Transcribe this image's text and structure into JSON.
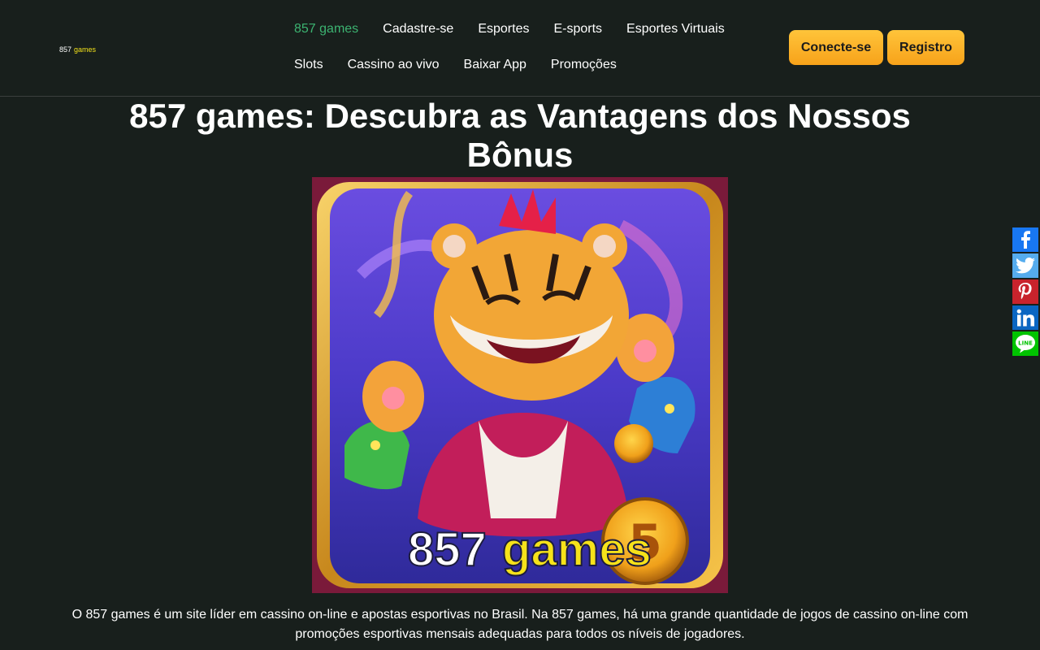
{
  "header": {
    "logo": {
      "number": "857",
      "word": "games"
    },
    "nav": {
      "row1": [
        "857 games",
        "Cadastre-se",
        "Esportes",
        "E-sports",
        "Esportes Virtuais"
      ],
      "row2": [
        "Slots",
        "Cassino ao vivo",
        "Baixar App",
        "Promoções"
      ],
      "active_item": "857 games"
    },
    "auth": {
      "login_label": "Conecte-se",
      "register_label": "Registro"
    }
  },
  "main": {
    "title": "857 games: Descubra as Vantagens dos Nossos Bônus",
    "hero_image": {
      "caption_number": "857",
      "caption_word": "games"
    },
    "intro": "O 857 games é um site líder em cassino on-line e apostas esportivas no Brasil. Na 857 games, há uma grande quantidade de jogos de cassino on-line com promoções esportivas mensais adequadas para todos os níveis de jogadores."
  },
  "share": {
    "buttons": [
      "facebook-icon",
      "twitter-icon",
      "pinterest-icon",
      "linkedin-icon",
      "line-icon"
    ],
    "colors": {
      "facebook": "#1877f2",
      "twitter": "#55acee",
      "pinterest": "#c8232c",
      "linkedin": "#0a66c2",
      "line": "#00c300"
    }
  },
  "colors": {
    "background": "#181f1c",
    "nav_active": "#3cb371",
    "button_gradient_top": "#ffc43a",
    "button_gradient_bottom": "#f7a21a",
    "logo_word": "#f2e11b"
  }
}
